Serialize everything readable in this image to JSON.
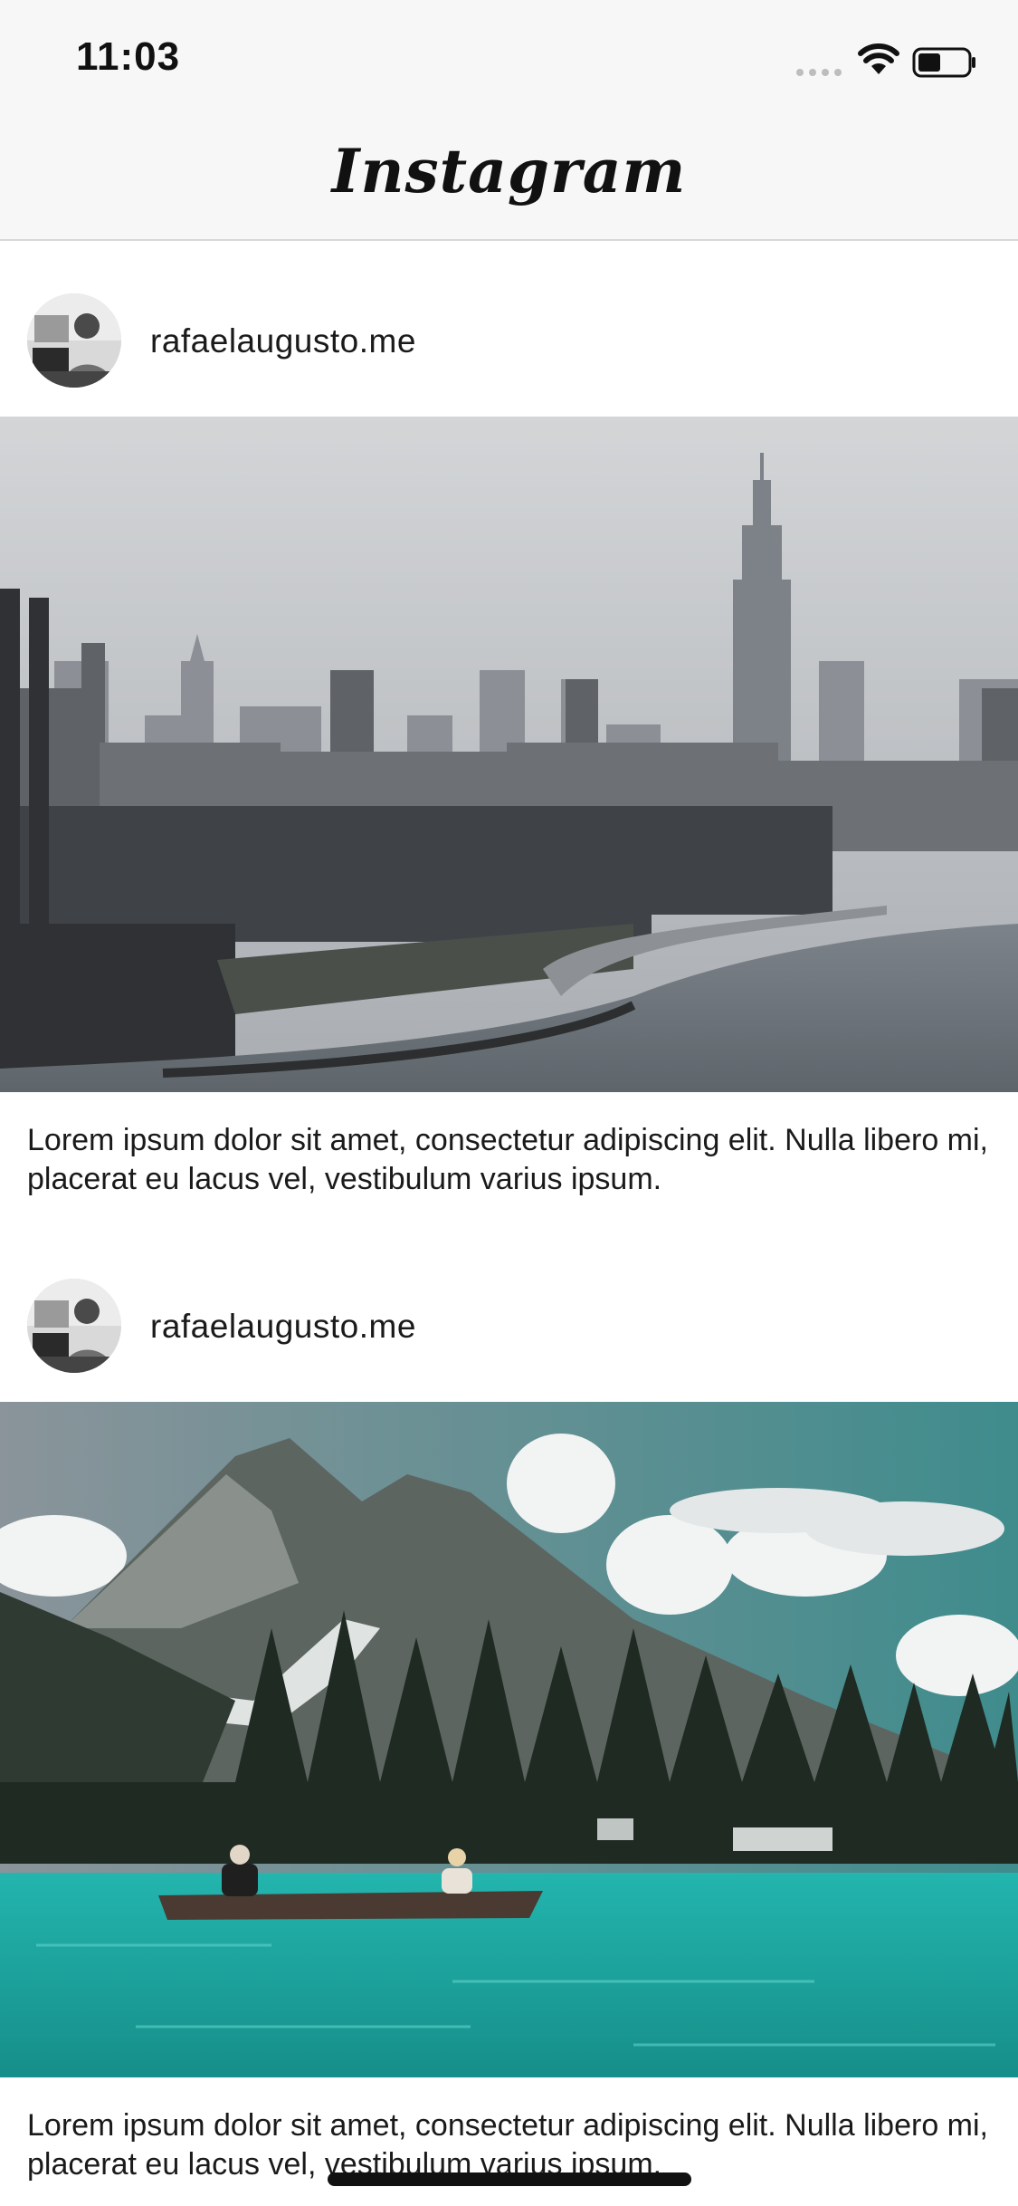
{
  "status_bar": {
    "time": "11:03",
    "icons": [
      "signal-dots-icon",
      "wifi-icon",
      "battery-icon"
    ]
  },
  "header": {
    "title": "Instagram"
  },
  "posts": [
    {
      "username": "rafaelaugusto.me",
      "image": "city-skyline-photo",
      "caption": "Lorem ipsum dolor sit amet, consectetur adipiscing elit. Nulla libero mi, placerat eu lacus vel, vestibulum varius ipsum."
    },
    {
      "username": "rafaelaugusto.me",
      "image": "mountain-lake-canoe-photo",
      "caption": "Lorem ipsum dolor sit amet, consectetur adipiscing elit. Nulla libero mi, placerat eu lacus vel, vestibulum varius ipsum."
    }
  ],
  "colors": {
    "header_background": "#f7f7f7",
    "lake": "#1ca8a2",
    "sky_city": "#c9cdd1"
  }
}
